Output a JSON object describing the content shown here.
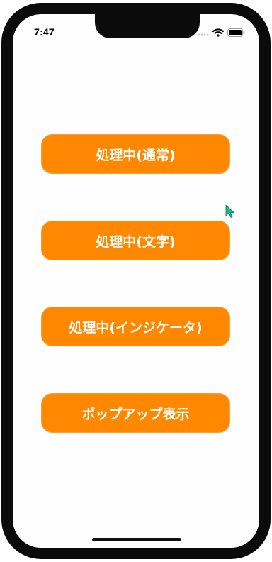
{
  "status_bar": {
    "time": "7:47"
  },
  "buttons": {
    "processing_normal": "処理中(通常)",
    "processing_text": "処理中(文字)",
    "processing_indicator": "処理中(インジケータ)",
    "popup_display": "ポップアップ表示"
  },
  "colors": {
    "button_bg": "#ff8800",
    "button_text": "#ffffff",
    "cursor": "#1fb88a"
  },
  "icons": [
    "signal-icon",
    "wifi-icon",
    "battery-icon",
    "cursor-icon"
  ]
}
